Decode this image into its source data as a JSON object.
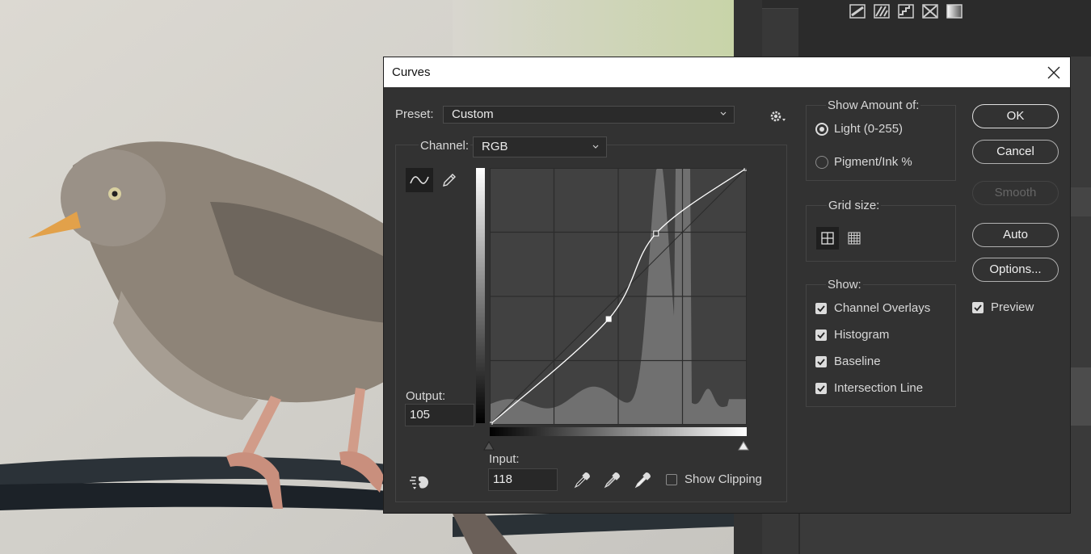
{
  "dialog": {
    "title": "Curves",
    "preset_label": "Preset:",
    "preset_value": "Custom",
    "channel_label": "Channel:",
    "channel_value": "RGB",
    "output_label": "Output:",
    "output_value": "105",
    "input_label": "Input:",
    "input_value": "118",
    "show_clipping_label": "Show Clipping",
    "show_clipping_checked": false
  },
  "show_amount": {
    "title": "Show Amount of:",
    "light_label": "Light  (0-255)",
    "pigment_label": "Pigment/Ink %",
    "selected": "light"
  },
  "grid_size": {
    "title": "Grid size:",
    "selected": "4x4"
  },
  "show": {
    "title": "Show:",
    "items": [
      {
        "label": "Channel Overlays",
        "checked": true
      },
      {
        "label": "Histogram",
        "checked": true
      },
      {
        "label": "Baseline",
        "checked": true
      },
      {
        "label": "Intersection Line",
        "checked": true
      }
    ]
  },
  "buttons": {
    "ok": "OK",
    "cancel": "Cancel",
    "smooth": "Smooth",
    "auto": "Auto",
    "options": "Options...",
    "preview_label": "Preview",
    "preview_checked": true
  },
  "curve_data": {
    "points": [
      [
        0,
        0
      ],
      [
        118,
        105
      ],
      [
        165,
        190
      ],
      [
        255,
        255
      ]
    ],
    "selected_point": [
      118,
      105
    ],
    "grid_divisions": 4
  },
  "icons": [
    "curve-tool-icon",
    "pencil-icon",
    "gear-icon",
    "eyedropper-black-icon",
    "eyedropper-gray-icon",
    "eyedropper-white-icon",
    "on-image-adjust-icon",
    "close-icon"
  ],
  "colors": {
    "dialog_bg": "#323232",
    "graph_bg": "#414141",
    "histogram": "#707070",
    "curve": "#ffffff"
  }
}
